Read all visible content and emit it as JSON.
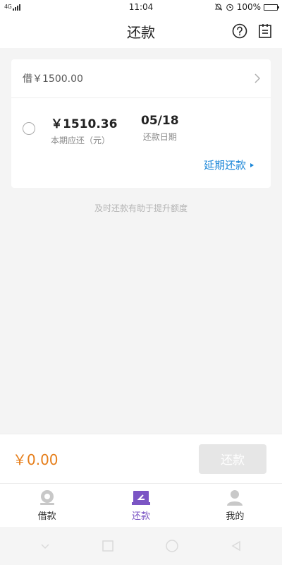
{
  "status_bar": {
    "network": "4G",
    "time": "11:04",
    "battery": "100%"
  },
  "header": {
    "title": "还款"
  },
  "loan": {
    "label": "借￥1500.00"
  },
  "bill": {
    "amount": "￥1510.36",
    "amount_caption": "本期应还（元）",
    "due_date": "05/18",
    "due_date_caption": "还款日期",
    "defer_label": "延期还款"
  },
  "tip": "及时还款有助于提升额度",
  "pay_bar": {
    "total": "￥0.00",
    "button_label": "还款"
  },
  "tabs": [
    {
      "label": "借款",
      "icon": "borrow-icon",
      "active": false
    },
    {
      "label": "还款",
      "icon": "repay-icon",
      "active": true
    },
    {
      "label": "我的",
      "icon": "profile-icon",
      "active": false
    }
  ],
  "colors": {
    "accent": "#7b55c4",
    "amount": "#e67e1a",
    "link": "#1a86d8"
  }
}
